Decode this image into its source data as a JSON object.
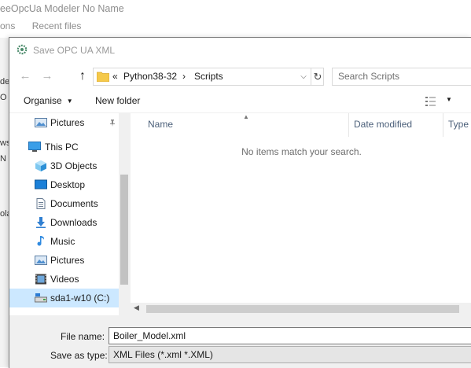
{
  "background_app": {
    "title": "eeOpcUa Modeler No Name",
    "menu": [
      "ons",
      "Recent files"
    ],
    "fragments": [
      "de",
      "O",
      "ws",
      "N",
      "ola"
    ]
  },
  "dialog": {
    "title": "Save OPC UA XML",
    "nav": {
      "back": "←",
      "forward": "→",
      "up": "↑"
    },
    "address": {
      "sep": "«",
      "crumbs": [
        "Python38-32",
        "Scripts"
      ],
      "arrow": "›"
    },
    "search": {
      "placeholder": "Search Scripts"
    },
    "toolbar": {
      "organise": "Organise",
      "new_folder": "New folder"
    },
    "sidebar": {
      "items": [
        {
          "label": "Pictures",
          "icon": "pictures-icon"
        },
        {
          "label": "This PC",
          "icon": "pc-icon"
        },
        {
          "label": "3D Objects",
          "icon": "3d-objects-icon"
        },
        {
          "label": "Desktop",
          "icon": "desktop-icon"
        },
        {
          "label": "Documents",
          "icon": "documents-icon"
        },
        {
          "label": "Downloads",
          "icon": "downloads-icon"
        },
        {
          "label": "Music",
          "icon": "music-icon"
        },
        {
          "label": "Pictures",
          "icon": "pictures-icon"
        },
        {
          "label": "Videos",
          "icon": "videos-icon"
        },
        {
          "label": "sda1-w10 (C:)",
          "icon": "drive-icon"
        }
      ]
    },
    "file_list": {
      "columns": [
        "Name",
        "Date modified",
        "Type"
      ],
      "empty_message": "No items match your search."
    },
    "file_name": {
      "label": "File name:",
      "value": "Boiler_Model.xml"
    },
    "save_as_type": {
      "label": "Save as type:",
      "value": "XML Files (*.xml *.XML)"
    }
  },
  "colors": {
    "selection": "#cce8ff",
    "folder": "#f5c94a",
    "accent": "#0078d7"
  }
}
